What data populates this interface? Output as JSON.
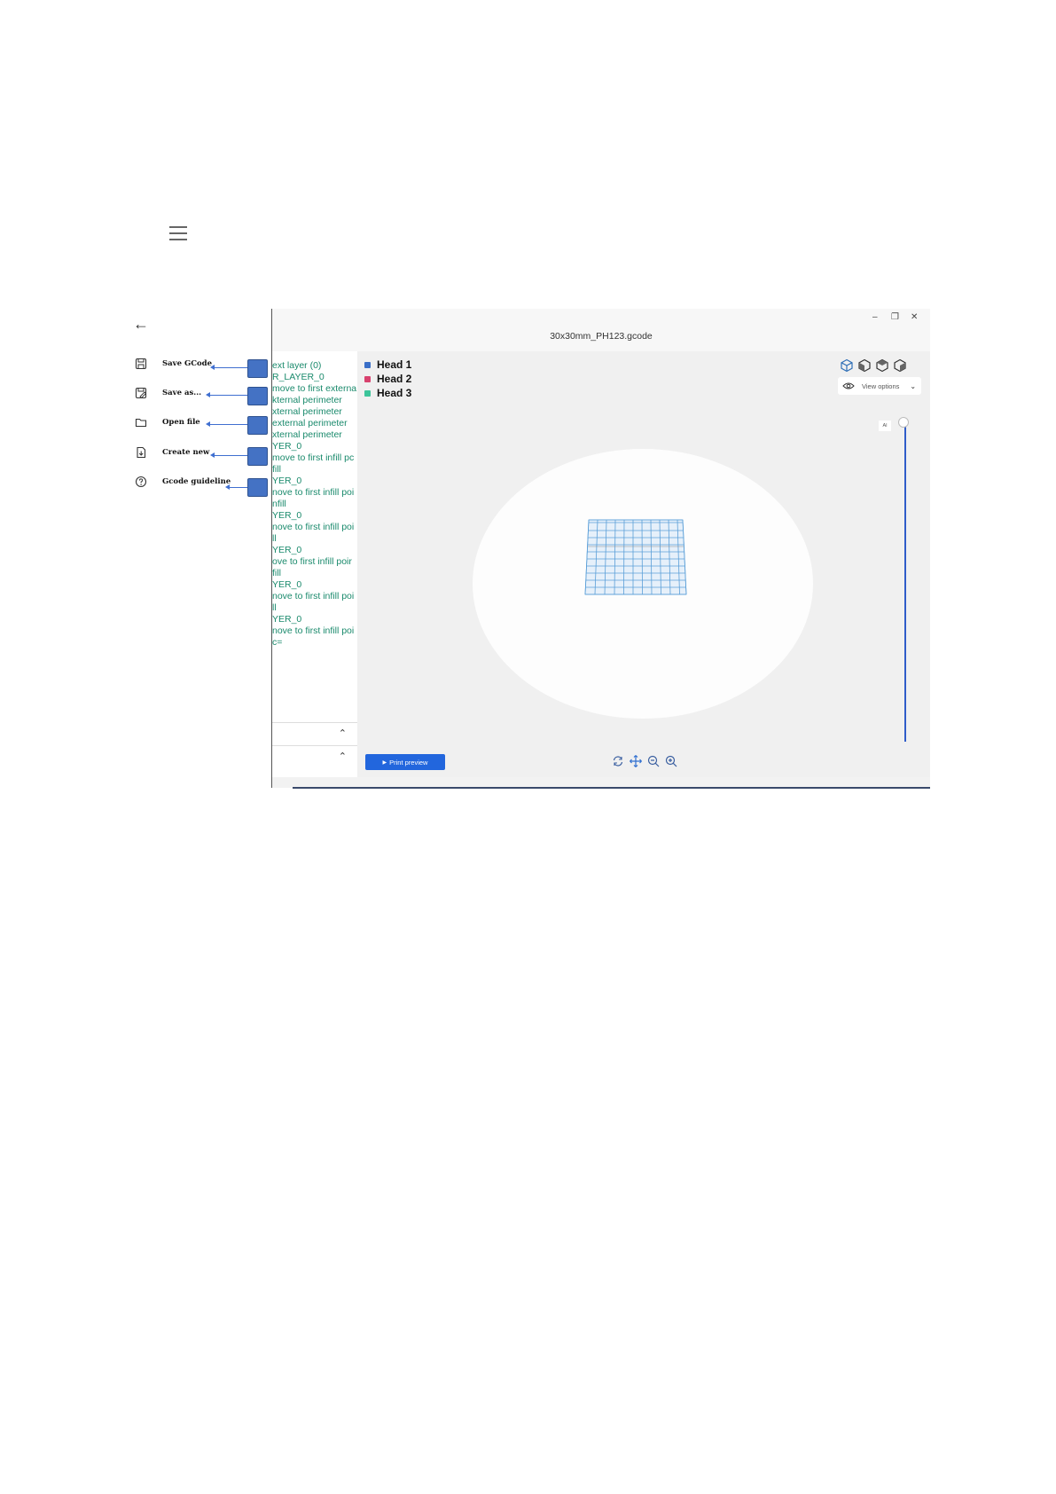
{
  "menu": {
    "items": [
      {
        "label": "Save GCode",
        "icon": "save-icon"
      },
      {
        "label": "Save as...",
        "icon": "save-as-icon"
      },
      {
        "label": "Open file",
        "icon": "folder-icon"
      },
      {
        "label": "Create new",
        "icon": "new-file-icon"
      },
      {
        "label": "Gcode guideline",
        "icon": "help-icon"
      }
    ]
  },
  "window": {
    "title": "30x30mm_PH123.gcode",
    "minimize": "–",
    "maximize": "❐",
    "close": "✕"
  },
  "gcode_lines": [
    "ext layer (0)",
    "R_LAYER_0",
    "move to first externa",
    "",
    "kternal perimeter",
    "xternal perimeter",
    "external perimeter",
    "xternal perimeter",
    "YER_0",
    "move to first infill pc",
    "",
    "fill",
    "YER_0",
    "nove to first infill poi",
    "",
    "nfill",
    "YER_0",
    "nove to first infill poi",
    "",
    "ll",
    "YER_0",
    "ove to first infill poir",
    "",
    "fill",
    "YER_0",
    "nove to first infill poi",
    "",
    "ll",
    "YER_0",
    "nove to first infill poi",
    "",
    "c="
  ],
  "legend": [
    {
      "label": "Head 1",
      "color": "#3a6fc8"
    },
    {
      "label": "Head 2",
      "color": "#d8416e"
    },
    {
      "label": "Head 3",
      "color": "#3cc49a"
    }
  ],
  "view_options": {
    "label": "View options"
  },
  "layer_slider": {
    "top_label": "Al"
  },
  "buttons": {
    "print_preview": "Print preview"
  },
  "colors": {
    "accent": "#2266dd",
    "gcode_text": "#1a8a6c",
    "callout": "#4472c4"
  }
}
